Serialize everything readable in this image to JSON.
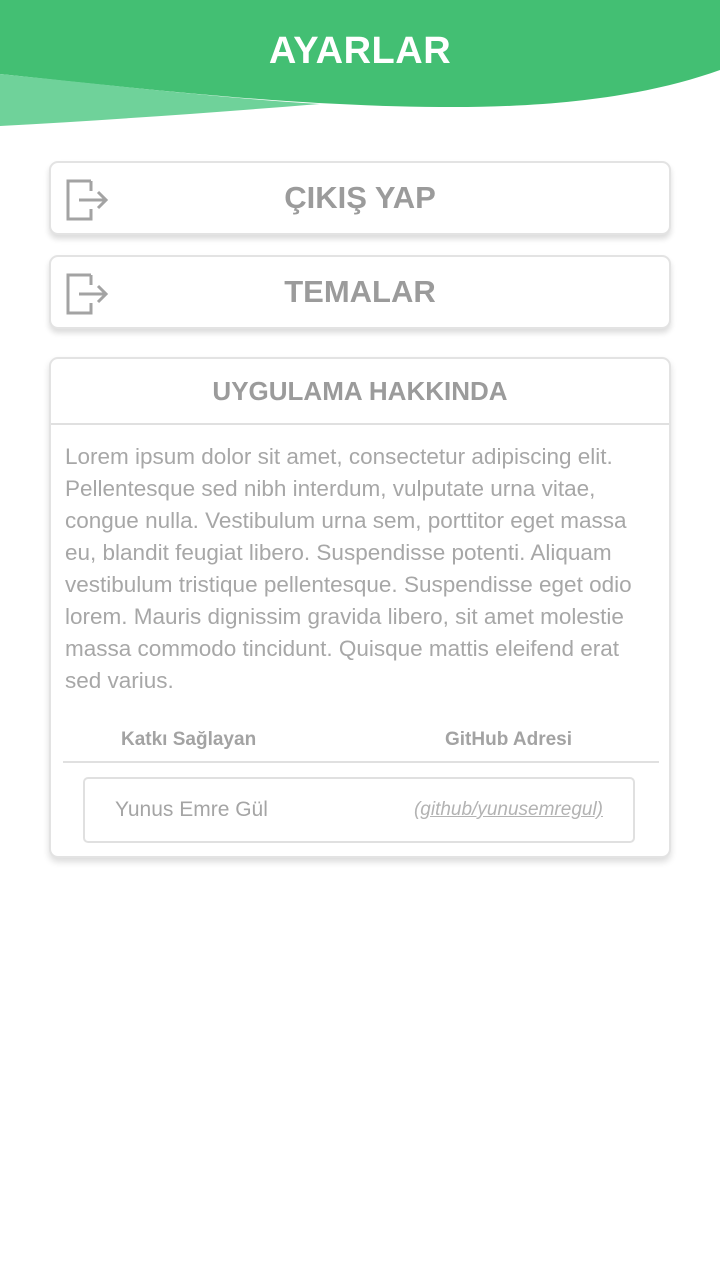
{
  "header": {
    "title": "AYARLAR",
    "color": "#43bf73",
    "light_color": "#6fd29a"
  },
  "menu": {
    "logout": {
      "label": "ÇIKIŞ YAP",
      "icon": "logout-icon"
    },
    "themes": {
      "label": "TEMALAR",
      "icon": "logout-icon"
    }
  },
  "about": {
    "title": "UYGULAMA HAKKINDA",
    "text": "Lorem ipsum dolor sit amet, consectetur adipiscing elit. Pellentesque sed nibh interdum, vulputate urna vitae, congue nulla. Vestibulum urna sem, porttitor eget massa eu, blandit feugiat libero. Suspendisse potenti. Aliquam vestibulum tristique pellentesque. Suspendisse eget odio lorem. Mauris dignissim gravida libero, sit amet molestie massa commodo tincidunt. Quisque mattis eleifend erat sed varius.",
    "contributors_header": {
      "name_label": "Katkı Sağlayan",
      "github_label": "GitHub Adresi"
    },
    "contributors": [
      {
        "name": "Yunus Emre Gül",
        "github": "(github/yunusemregul)"
      }
    ]
  }
}
